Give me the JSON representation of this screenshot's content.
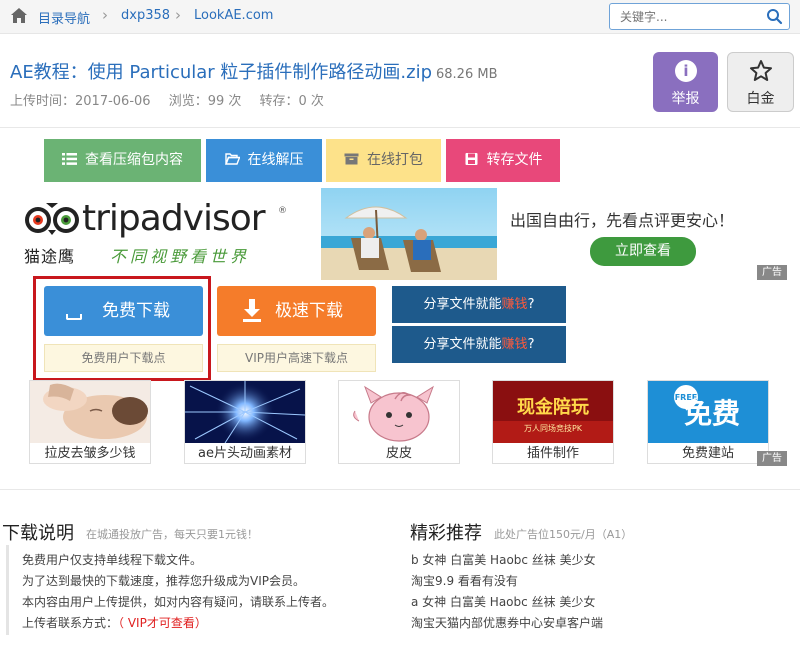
{
  "nav": {
    "breadcrumbs": [
      "目录导航",
      "dxp358",
      "LookAE.com"
    ],
    "search_placeholder": "关键字..."
  },
  "file": {
    "title": "AE教程：使用 Particular 粒子插件制作路径动画.zip",
    "size": "68.26 MB",
    "upload_time": "上传时间：2017-06-06",
    "views": "浏览：99 次",
    "saves": "转存：0 次",
    "report_label": "举报",
    "gold_label": "白金"
  },
  "actions": {
    "view_contents": "查看压缩包内容",
    "unzip_online": "在线解压",
    "pack_online": "在线打包",
    "save_file": "转存文件"
  },
  "ad_banner": {
    "brand": "tripadvisor",
    "brand_cn": "猫途鹰",
    "slogan": "不同视野看世界",
    "text": "出国自由行，先看点评更安心！",
    "cta": "立即查看",
    "tag": "广告"
  },
  "download": {
    "free_label": "免费下载",
    "free_sub": "免费用户下载点",
    "fast_label": "极速下载",
    "fast_sub": "VIP用户高速下载点",
    "share1_prefix": "分享文件就能",
    "share1_red": "赚钱",
    "share1_suffix": "?",
    "share2_prefix": "分享文件就能",
    "share2_red": "赚钱",
    "share2_suffix": "?"
  },
  "thumbs": [
    {
      "caption": "拉皮去皱多少钱"
    },
    {
      "caption": "ae片头动画素材"
    },
    {
      "caption": "皮皮"
    },
    {
      "caption": "插件制作",
      "img_text": "现金陪玩",
      "img_sub": "万人同场竞技PK"
    },
    {
      "caption": "免费建站",
      "img_text": "免费",
      "img_badge": "FREE"
    }
  ],
  "thumbs_tag": "广告",
  "instructions": {
    "title": "下载说明",
    "note": "在城通投放广告，每天只要1元钱！",
    "lines": [
      "免费用户仅支持单线程下载文件。",
      "为了达到最快的下载速度，推荐您升级成为VIP会员。",
      "本内容由用户上传提供，如对内容有疑问，请联系上传者。"
    ],
    "contact_prefix": "上传者联系方式：",
    "contact_vip": "（ VIP才可查看）"
  },
  "recommend": {
    "title": "精彩推荐",
    "note": "此处广告位150元/月（A1）",
    "items": [
      "b 女神 白富美 Haobc 丝袜 美少女",
      "淘宝9.9 看看有没有",
      "a 女神 白富美 Haobc 丝袜 美少女",
      "淘宝天猫内部优惠券中心安卓客户端"
    ]
  },
  "colors": {
    "link": "#2a6ebb",
    "view_btn": "#6bb374",
    "unzip_btn": "#3a8fd8",
    "pack_btn": "#fde28a",
    "save_btn": "#e8487a",
    "report_btn": "#8a6fbf",
    "free_btn": "#3a8fd8",
    "fast_btn": "#f57c2a",
    "share_btn": "#1e5a8c",
    "highlight_border": "#c8171d"
  }
}
